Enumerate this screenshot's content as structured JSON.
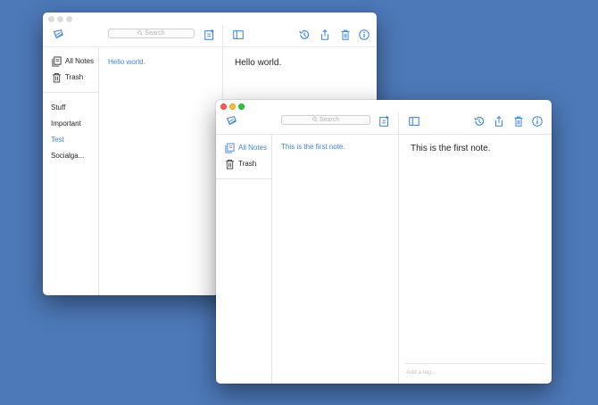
{
  "colors": {
    "desktop": "#4d79b9",
    "accent": "#3d85d8"
  },
  "icons": {
    "logo": "simplenote-logo-icon",
    "new_note": "new-note-icon",
    "toggle_sidebar": "sidebar-toggle-icon",
    "history": "history-icon",
    "share": "share-icon",
    "trash": "trash-icon",
    "info": "info-icon",
    "all_notes": "notes-stack-icon",
    "search": "magnifier-icon"
  },
  "back_window": {
    "search": {
      "placeholder": "Search"
    },
    "nav": {
      "all_notes": "All Notes",
      "trash": "Trash"
    },
    "tags": [
      "Stuff",
      "Important",
      "Test",
      "Socialga..."
    ],
    "active_tag": "Test",
    "notes": [
      "Hello world."
    ],
    "editor_text": "Hello world."
  },
  "front_window": {
    "search": {
      "placeholder": "Search"
    },
    "nav": {
      "all_notes": "All Notes",
      "trash": "Trash"
    },
    "notes": [
      "This is the first note."
    ],
    "editor_text": "This is the first note.",
    "tag_field": {
      "placeholder": "Add a tag..."
    }
  }
}
